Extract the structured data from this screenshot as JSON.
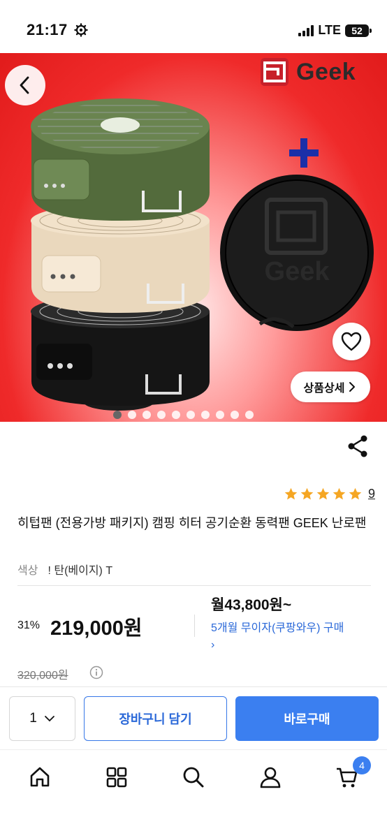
{
  "status_bar": {
    "time": "21:17",
    "network": "LTE",
    "battery": "52"
  },
  "hero": {
    "brand": "Geek",
    "pouch_text": "Geek",
    "detail_button": "상품상세",
    "image_count": 10,
    "active_image_index": 0,
    "background_color": "#e11b1b"
  },
  "product": {
    "rating_stars": 5,
    "review_count": "9",
    "title": "히텁팬 (전용가방 패키지) 캠핑 히터 공기순환 동력팬 GEEK 난로팬",
    "option_label": "색상",
    "option_value": "! 탄(베이지) T",
    "discount_rate": "31%",
    "price": "219,000원",
    "monthly_price": "월43,800원~",
    "installment_text": "5개월 무이자(쿠팡와우) 구매",
    "original_price": "320,000원"
  },
  "purchase_bar": {
    "quantity": "1",
    "cart_label": "장바구니 담기",
    "buy_label": "바로구매",
    "accent_color": "#3b7ff0"
  },
  "bottom_nav": {
    "items": [
      "home-icon",
      "category-icon",
      "search-icon",
      "my-page-icon",
      "cart-icon"
    ],
    "cart_badge": "4"
  }
}
